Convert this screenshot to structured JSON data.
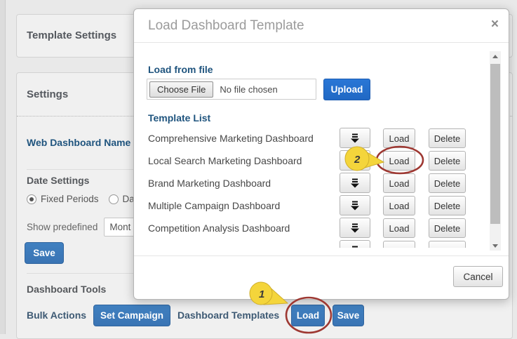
{
  "background": {
    "template_settings_title": "Template Settings",
    "settings_title": "Settings",
    "web_dashboard_name": "Web Dashboard Name",
    "date_settings": "Date Settings",
    "fixed_periods": "Fixed Periods",
    "date_option_clipped": "Dat",
    "show_predefined": "Show predefined",
    "predefined_value": "Mont",
    "save_button": "Save",
    "dashboard_tools": "Dashboard Tools",
    "bulk_actions": "Bulk Actions",
    "set_campaign_button": "Set Campaign",
    "dashboard_templates": "Dashboard Templates",
    "load_button": "Load",
    "save_button2": "Save"
  },
  "modal": {
    "title": "Load Dashboard Template",
    "close_glyph": "×",
    "load_from_file": "Load from file",
    "file_input": {
      "button": "Choose File",
      "status": "No file chosen"
    },
    "upload_button": "Upload",
    "template_list": "Template List",
    "templates": [
      {
        "name": "Comprehensive Marketing Dashboard"
      },
      {
        "name": "Local Search Marketing Dashboard"
      },
      {
        "name": "Brand Marketing Dashboard"
      },
      {
        "name": "Multiple Campaign Dashboard"
      },
      {
        "name": "Competition Analysis Dashboard"
      }
    ],
    "row_buttons": {
      "load": "Load",
      "delete": "Delete"
    },
    "cancel_button": "Cancel"
  },
  "annotations": {
    "step1": "1",
    "step2": "2",
    "balloon_fill": "#f4d53b",
    "balloon_stroke": "#cfae2c",
    "circle_stroke": "#9e3832"
  },
  "colors": {
    "accent_blue": "#3a76b8",
    "upload_blue": "#2471d0",
    "navy_heading": "#1f547e",
    "page_bg": "#e9e9e9"
  }
}
